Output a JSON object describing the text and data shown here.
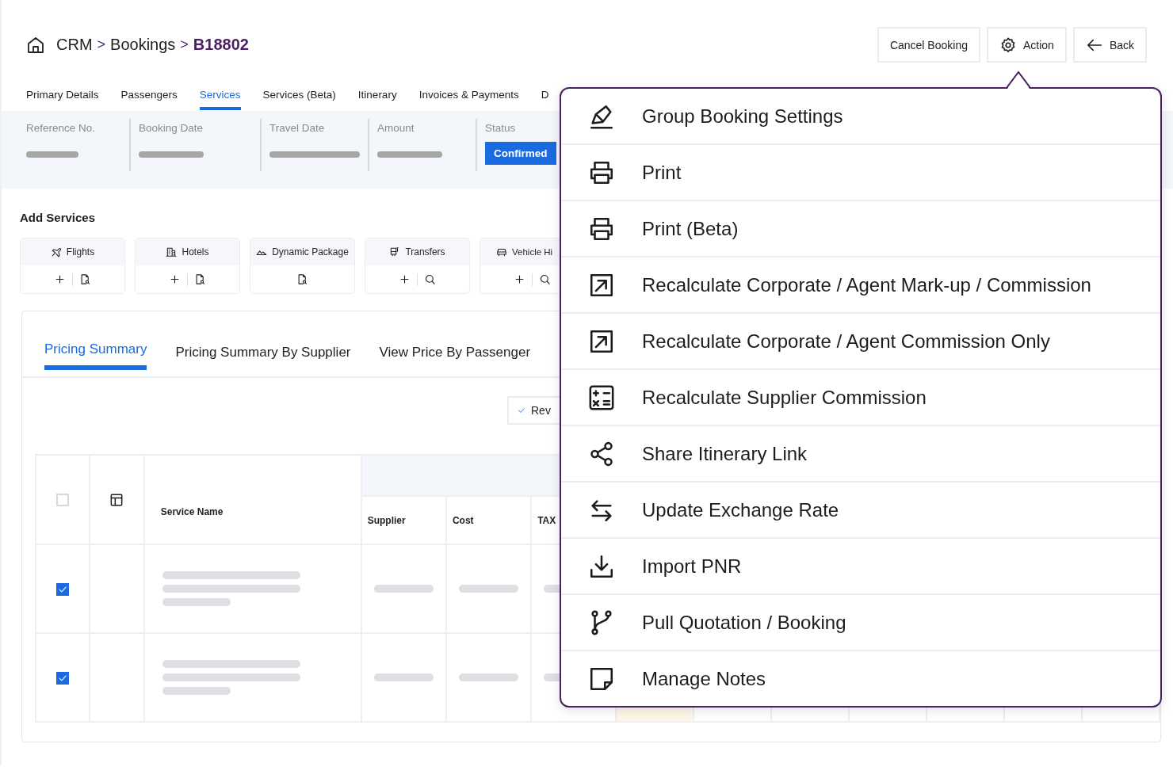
{
  "breadcrumb": [
    {
      "label": "CRM",
      "current": false
    },
    {
      "separator": ">",
      "label": "Bookings",
      "current": false
    },
    {
      "separator": ">",
      "label": "B18802",
      "current": true
    }
  ],
  "header_buttons": [
    {
      "label": "Cancel Booking"
    },
    {
      "label": "Action"
    },
    {
      "label": "Back"
    }
  ],
  "tabs": [
    {
      "label": "Primary Details",
      "selected": false
    },
    {
      "label": "Passengers",
      "selected": false
    },
    {
      "label": "Services",
      "selected": true
    },
    {
      "label": "Services (Beta)",
      "selected": false
    },
    {
      "label": "Itinerary",
      "selected": false
    },
    {
      "label": "Invoices & Payments",
      "selected": false
    },
    {
      "label": "D",
      "selected": false
    }
  ],
  "summary": [
    {
      "label": "Reference No.",
      "kind": "skeleton"
    },
    {
      "label": "Booking Date",
      "kind": "skeleton"
    },
    {
      "label": "Travel Date",
      "kind": "skeleton"
    },
    {
      "label": "Amount",
      "kind": "skeleton"
    },
    {
      "label": "Status",
      "kind": "badge",
      "value": "Confirmed"
    }
  ],
  "add_services": {
    "title": "Add Services",
    "cards": [
      {
        "label": "Flights",
        "kind": "document"
      },
      {
        "label": "Hotels",
        "kind": "document"
      },
      {
        "label": "Dynamic Package",
        "kind": "package"
      },
      {
        "label": "Transfers",
        "kind": "search"
      },
      {
        "label": "Vehicle Hi",
        "kind": "search"
      }
    ]
  },
  "pricing_tabs": [
    {
      "label": "Pricing Summary",
      "selected": true
    },
    {
      "label": "Pricing Summary By Supplier",
      "selected": false
    },
    {
      "label": "View Price By Passenger",
      "selected": false
    }
  ],
  "review_button": {
    "label": "Rev"
  },
  "table": {
    "select_all_checked": false,
    "columns": [
      "Service Name",
      "Supplier",
      "Cost",
      "TAX"
    ],
    "rows": [
      {
        "checked": true
      },
      {
        "checked": true
      }
    ]
  },
  "action_menu": [
    {
      "label": "Group Booking Settings"
    },
    {
      "label": "Print"
    },
    {
      "label": "Print (Beta)"
    },
    {
      "label": "Recalculate Corporate / Agent Mark-up / Commission"
    },
    {
      "label": "Recalculate Corporate / Agent Commission Only"
    },
    {
      "label": "Recalculate Supplier Commission"
    },
    {
      "label": "Share Itinerary Link"
    },
    {
      "label": "Update Exchange Rate"
    },
    {
      "label": "Import PNR"
    },
    {
      "label": "Pull Quotation / Booking"
    },
    {
      "label": "Manage Notes"
    }
  ]
}
